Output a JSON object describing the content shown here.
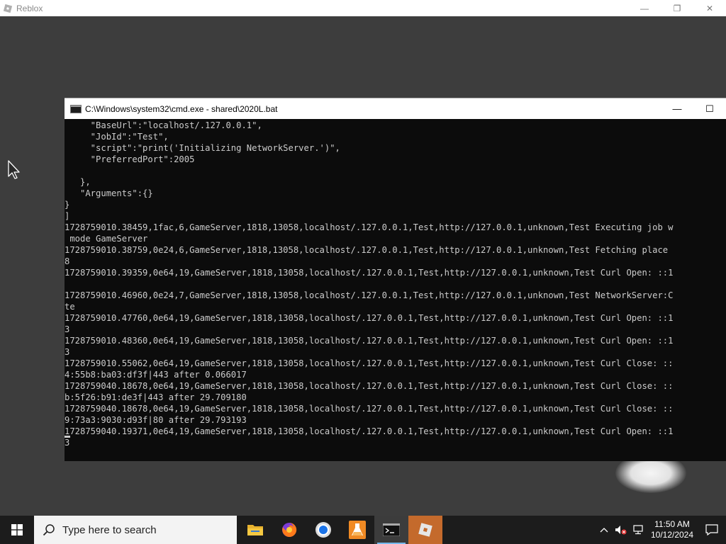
{
  "roblox_window": {
    "title": "Reblox",
    "controls": {
      "minimize": "—",
      "restore": "❐",
      "close": "✕"
    }
  },
  "cmd_window": {
    "title": "C:\\Windows\\system32\\cmd.exe - shared\\2020L.bat",
    "controls": {
      "minimize": "—",
      "maximize": "☐"
    },
    "lines": [
      "     \"BaseUrl\":\"localhost/.127.0.0.1\",",
      "     \"JobId\":\"Test\",",
      "     \"script\":\"print('Initializing NetworkServer.')\",",
      "     \"PreferredPort\":2005",
      "",
      "   },",
      "   \"Arguments\":{}",
      "}",
      "]",
      "1728759010.38459,1fac,6,GameServer,1818,13058,localhost/.127.0.0.1,Test,http://127.0.0.1,unknown,Test Executing job w",
      " mode GameServer",
      "1728759010.38759,0e24,6,GameServer,1818,13058,localhost/.127.0.0.1,Test,http://127.0.0.1,unknown,Test Fetching place",
      "8",
      "1728759010.39359,0e64,19,GameServer,1818,13058,localhost/.127.0.0.1,Test,http://127.0.0.1,unknown,Test Curl Open: ::1",
      "",
      "1728759010.46960,0e24,7,GameServer,1818,13058,localhost/.127.0.0.1,Test,http://127.0.0.1,unknown,Test NetworkServer:C",
      "te",
      "1728759010.47760,0e64,19,GameServer,1818,13058,localhost/.127.0.0.1,Test,http://127.0.0.1,unknown,Test Curl Open: ::1",
      "3",
      "1728759010.48360,0e64,19,GameServer,1818,13058,localhost/.127.0.0.1,Test,http://127.0.0.1,unknown,Test Curl Open: ::1",
      "3",
      "1728759010.55062,0e64,19,GameServer,1818,13058,localhost/.127.0.0.1,Test,http://127.0.0.1,unknown,Test Curl Close: ::",
      "4:55b8:ba03:df3f|443 after 0.066017",
      "1728759040.18678,0e64,19,GameServer,1818,13058,localhost/.127.0.0.1,Test,http://127.0.0.1,unknown,Test Curl Close: ::",
      "b:5f26:b91:de3f|443 after 29.709180",
      "1728759040.18678,0e64,19,GameServer,1818,13058,localhost/.127.0.0.1,Test,http://127.0.0.1,unknown,Test Curl Close: ::",
      "9:73a3:9030:d93f|80 after 29.793193",
      "1728759040.19371,0e64,19,GameServer,1818,13058,localhost/.127.0.0.1,Test,http://127.0.0.1,unknown,Test Curl Open: ::1",
      "3"
    ]
  },
  "taskbar": {
    "search_placeholder": "Type here to search",
    "apps": [
      "file-explorer-icon",
      "firefox-icon",
      "chrome-icon",
      "lab-flask-icon",
      "cmd-icon",
      "roblox-icon"
    ],
    "clock": {
      "time": "11:50 AM",
      "date": "10/12/2024"
    }
  },
  "colors": {
    "console_bg": "#0c0c0c",
    "console_text": "#cccccc",
    "taskbar_bg": "#1c1c1c",
    "roblox_active_tile": "#c46a2c"
  }
}
